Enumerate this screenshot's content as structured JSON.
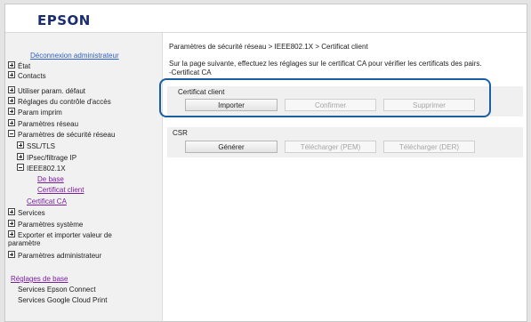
{
  "header": {
    "logo": "EPSON"
  },
  "sidebar": {
    "logout_link": "Déconnexion administrateur",
    "items": [
      {
        "label": "État"
      },
      {
        "label": "Contacts"
      },
      {
        "label": "Utiliser param. défaut"
      },
      {
        "label": "Réglages du contrôle d'accès"
      },
      {
        "label": "Param imprim"
      },
      {
        "label": "Paramètres réseau"
      },
      {
        "label": "Paramètres de sécurité réseau"
      },
      {
        "label": "SSL/TLS"
      },
      {
        "label": "IPsec/filtrage IP"
      },
      {
        "label": "IEEE802.1X"
      },
      {
        "label": "De base"
      },
      {
        "label": "Certificat client"
      },
      {
        "label": "Certificat CA"
      },
      {
        "label": "Services"
      },
      {
        "label": "Paramètres système"
      },
      {
        "label": "Exporter et importer valeur de"
      },
      {
        "label": "paramètre"
      },
      {
        "label": "Paramètres administrateur"
      }
    ],
    "basic_settings_link": "Réglages de base",
    "sub_items": [
      {
        "label": "Services Epson Connect"
      },
      {
        "label": "Services Google Cloud Print"
      }
    ]
  },
  "main": {
    "breadcrumb": "Paramètres de sécurité réseau > IEEE802.1X > Certificat client",
    "description_line1": "Sur la page suivante, effectuez les réglages sur le certificat CA pour vérifier les certificats des pairs.",
    "description_line2": "-Certificat CA",
    "client_cert": {
      "title": "Certificat client",
      "import_label": "Importer",
      "confirm_label": "Confirmer",
      "delete_label": "Supprimer"
    },
    "csr": {
      "title": "CSR",
      "generate_label": "Générer",
      "download_pem_label": "Télécharger (PEM)",
      "download_der_label": "Télécharger (DER)"
    }
  },
  "colors": {
    "highlight_border": "#1b5fa3",
    "link_blue": "#2f5ec4",
    "visited_purple": "#7a1e9e",
    "logo": "#1a2e6f"
  }
}
